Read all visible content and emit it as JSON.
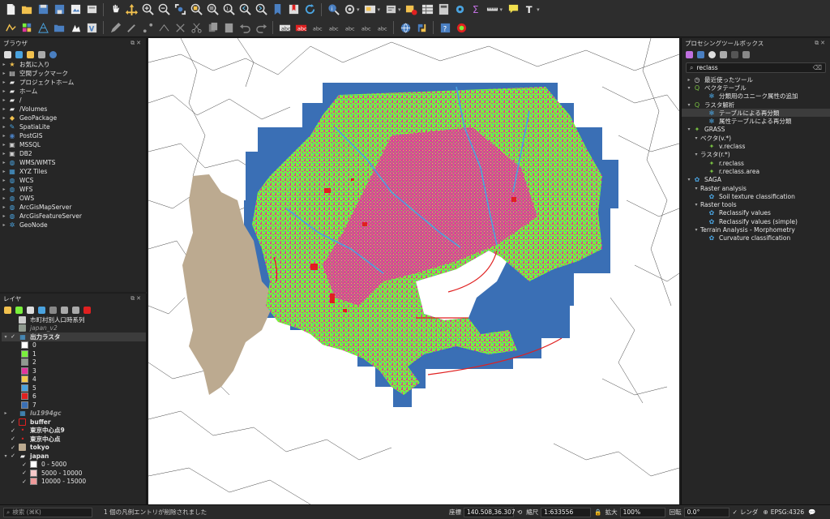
{
  "browser": {
    "title": "ブラウザ",
    "items": [
      {
        "label": "お気に入り",
        "icon": "star-icon"
      },
      {
        "label": "空間ブックマーク",
        "icon": "bookmark-folder-icon"
      },
      {
        "label": "プロジェクトホーム",
        "icon": "folder-icon"
      },
      {
        "label": "ホーム",
        "icon": "folder-icon"
      },
      {
        "label": "/",
        "icon": "folder-icon"
      },
      {
        "label": "/Volumes",
        "icon": "folder-icon"
      },
      {
        "label": "GeoPackage",
        "icon": "geopackage-icon"
      },
      {
        "label": "SpatiaLite",
        "icon": "spatialite-icon"
      },
      {
        "label": "PostGIS",
        "icon": "postgis-icon"
      },
      {
        "label": "MSSQL",
        "icon": "mssql-icon"
      },
      {
        "label": "DB2",
        "icon": "db2-icon"
      },
      {
        "label": "WMS/WMTS",
        "icon": "globe-icon"
      },
      {
        "label": "XYZ Tiles",
        "icon": "tiles-icon"
      },
      {
        "label": "WCS",
        "icon": "globe-icon"
      },
      {
        "label": "WFS",
        "icon": "globe-icon"
      },
      {
        "label": "OWS",
        "icon": "globe-icon"
      },
      {
        "label": "ArcGisMapServer",
        "icon": "globe-icon"
      },
      {
        "label": "ArcGisFeatureServer",
        "icon": "globe-icon"
      },
      {
        "label": "GeoNode",
        "icon": "geonode-icon"
      }
    ]
  },
  "layers": {
    "title": "レイヤ",
    "group_label": "市町村別人口時系列",
    "japan_v2": "japan_v2",
    "output_raster": "出力ラスタ",
    "raster_classes": [
      {
        "value": "0",
        "color": "#ffffff"
      },
      {
        "value": "1",
        "color": "#79f03c"
      },
      {
        "value": "2",
        "color": "#8f9a8f"
      },
      {
        "value": "3",
        "color": "#e0359e"
      },
      {
        "value": "4",
        "color": "#f2c94c"
      },
      {
        "value": "5",
        "color": "#4aa3df"
      },
      {
        "value": "6",
        "color": "#e02020"
      },
      {
        "value": "7",
        "color": "#3a6fb5"
      }
    ],
    "lu_layer": "lu1994gc",
    "buffer": "buffer",
    "tokyo_center9": "東京中心点9",
    "tokyo_center": "東京中心点",
    "tokyo": "tokyo",
    "japan": "japan",
    "japan_classes": [
      {
        "label": "0 - 5000",
        "color": "#ffffff"
      },
      {
        "label": "5000 - 10000",
        "color": "#f6c9c9"
      },
      {
        "label": "10000 - 15000",
        "color": "#ef9a9a"
      }
    ]
  },
  "toolbox": {
    "title": "プロセシングツールボックス",
    "search_value": "reclass",
    "items": [
      {
        "label": "最近使ったツール",
        "icon": "clock-icon",
        "indent": 0,
        "arrow": "▸"
      },
      {
        "label": "ベクタテーブル",
        "icon": "qgis-icon",
        "indent": 0,
        "arrow": "▾"
      },
      {
        "label": "分類用のユニーク属性の追加",
        "icon": "gear-icon",
        "indent": 2,
        "arrow": ""
      },
      {
        "label": "ラスタ解析",
        "icon": "qgis-icon",
        "indent": 0,
        "arrow": "▾"
      },
      {
        "label": "テーブルによる再分類",
        "icon": "gear-icon",
        "indent": 2,
        "arrow": ""
      },
      {
        "label": "属性テーブルによる再分類",
        "icon": "gear-icon",
        "indent": 2,
        "arrow": ""
      },
      {
        "label": "GRASS",
        "icon": "grass-icon",
        "indent": 0,
        "arrow": "▾"
      },
      {
        "label": "ベクタ(v.*)",
        "icon": "",
        "indent": 1,
        "arrow": "▾"
      },
      {
        "label": "v.reclass",
        "icon": "grass-icon",
        "indent": 2,
        "arrow": ""
      },
      {
        "label": "ラスタ(r.*)",
        "icon": "",
        "indent": 1,
        "arrow": "▾"
      },
      {
        "label": "r.reclass",
        "icon": "grass-icon",
        "indent": 2,
        "arrow": ""
      },
      {
        "label": "r.reclass.area",
        "icon": "grass-icon",
        "indent": 2,
        "arrow": ""
      },
      {
        "label": "SAGA",
        "icon": "saga-icon",
        "indent": 0,
        "arrow": "▾"
      },
      {
        "label": "Raster analysis",
        "icon": "",
        "indent": 1,
        "arrow": "▾"
      },
      {
        "label": "Soil texture classification",
        "icon": "saga-icon",
        "indent": 2,
        "arrow": ""
      },
      {
        "label": "Raster tools",
        "icon": "",
        "indent": 1,
        "arrow": "▾"
      },
      {
        "label": "Reclassify values",
        "icon": "saga-icon",
        "indent": 2,
        "arrow": ""
      },
      {
        "label": "Reclassify values (simple)",
        "icon": "saga-icon",
        "indent": 2,
        "arrow": ""
      },
      {
        "label": "Terrain Analysis - Morphometry",
        "icon": "",
        "indent": 1,
        "arrow": "▾"
      },
      {
        "label": "Curvature classification",
        "icon": "saga-icon",
        "indent": 2,
        "arrow": ""
      }
    ]
  },
  "status": {
    "search_placeholder": "検索 (⌘K)",
    "message": "1 個の凡例エントリが削除されました",
    "coord_label": "座標",
    "coord_value": "140.508,36.307",
    "scale_label": "縮尺",
    "scale_value": "1:633556",
    "magnifier_label": "拡大",
    "magnifier_value": "100%",
    "rotation_label": "回転",
    "rotation_value": "0.0°",
    "render_label": "レンダ",
    "crs": "EPSG:4326"
  },
  "colors": {
    "buffer_blue": "#3a6fb5",
    "green": "#79f03c",
    "magenta": "#e0359e",
    "tokyo_tan": "#bcaa90",
    "buffer_line": "#e02020"
  }
}
